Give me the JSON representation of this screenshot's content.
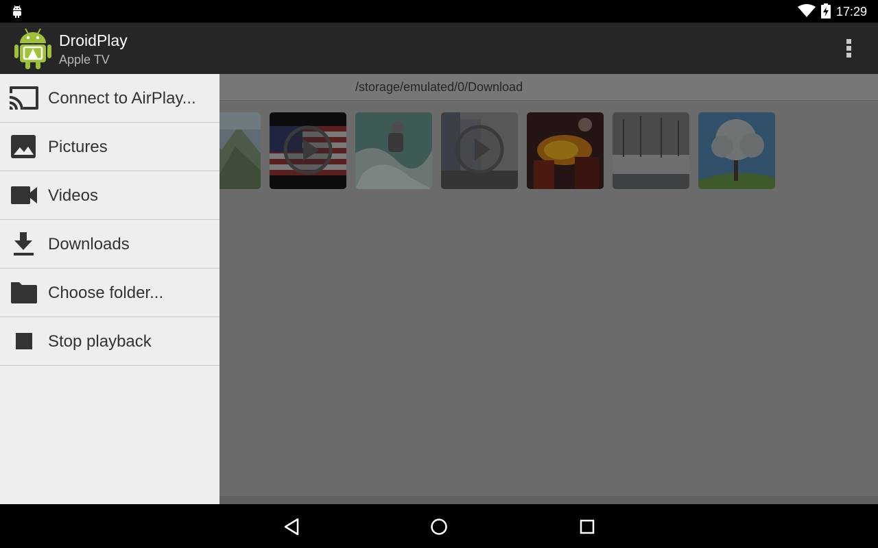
{
  "status_bar": {
    "time": "17:29",
    "icons": [
      "android-notification-icon",
      "wifi-icon",
      "battery-charging-icon"
    ]
  },
  "action_bar": {
    "title": "DroidPlay",
    "subtitle": "Apple TV",
    "icons": [
      "droidplay-app-icon",
      "overflow-menu-icon"
    ]
  },
  "content": {
    "path": "/storage/emulated/0/Download",
    "thumbnails": [
      {
        "name": "mountains-photo",
        "type": "image"
      },
      {
        "name": "american-flag-video",
        "type": "video"
      },
      {
        "name": "kayak-photo",
        "type": "image"
      },
      {
        "name": "city-street-video",
        "type": "video"
      },
      {
        "name": "fire-breather-photo",
        "type": "image"
      },
      {
        "name": "winter-trees-photo",
        "type": "image"
      },
      {
        "name": "blossom-tree-photo",
        "type": "image"
      }
    ]
  },
  "drawer": {
    "items": [
      {
        "label": "Connect to AirPlay...",
        "icon": "cast-icon"
      },
      {
        "label": "Pictures",
        "icon": "image-icon"
      },
      {
        "label": "Videos",
        "icon": "videocam-icon"
      },
      {
        "label": "Downloads",
        "icon": "download-icon"
      },
      {
        "label": "Choose folder...",
        "icon": "folder-icon"
      },
      {
        "label": "Stop playback",
        "icon": "stop-icon"
      }
    ]
  },
  "nav_bar": {
    "icons": [
      "back-icon",
      "home-icon",
      "recents-icon"
    ]
  },
  "colors": {
    "action_bar": "#262626",
    "drawer_bg": "#eeeeee",
    "dimmed_content": "#6b6b6b",
    "android_green": "#9fc237"
  }
}
